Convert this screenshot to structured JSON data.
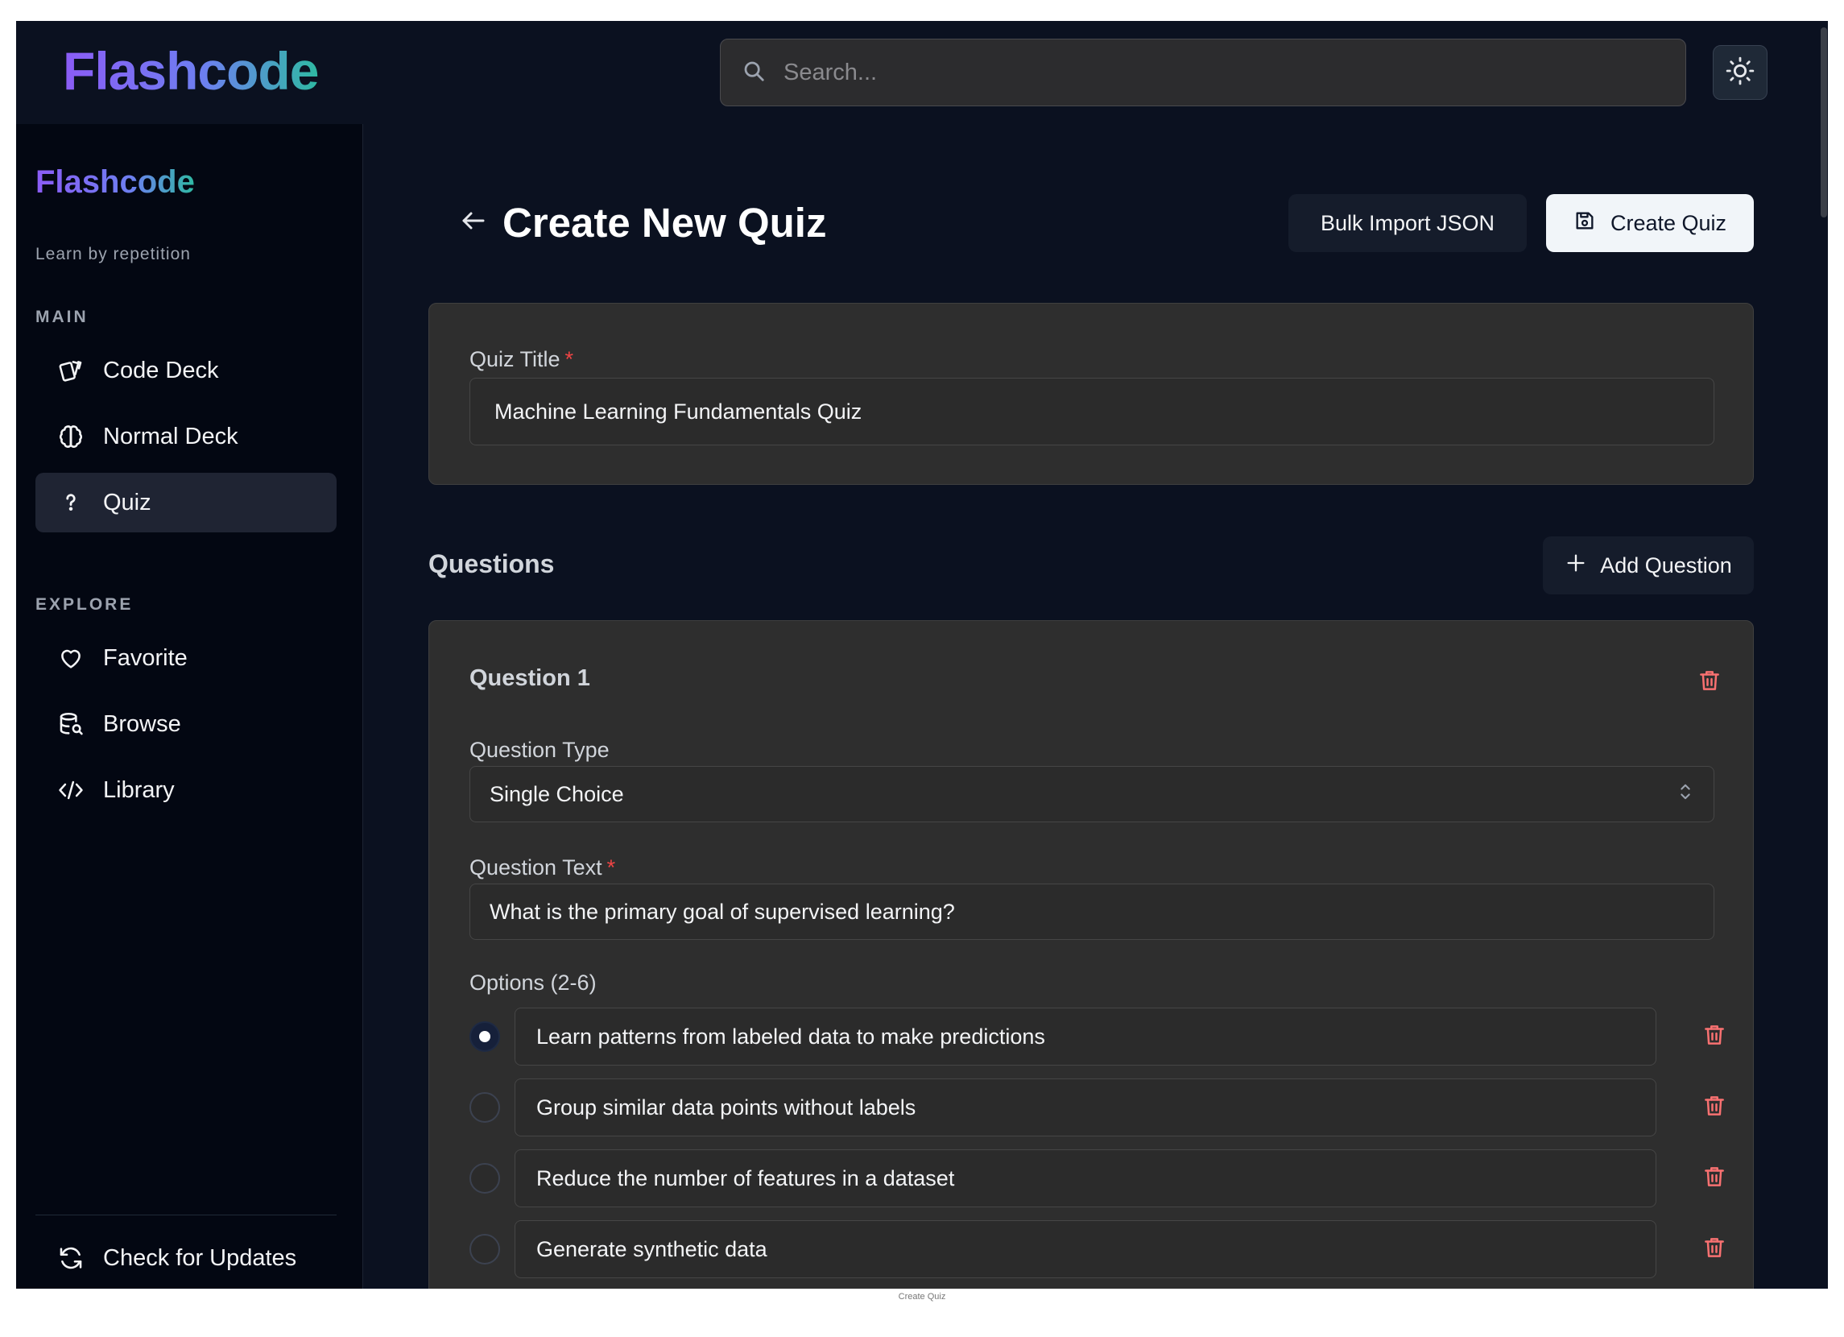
{
  "header": {
    "logo": "Flashcode",
    "search_placeholder": "Search...",
    "search_value": ""
  },
  "sidebar": {
    "brand": "Flashcode",
    "tagline": "Learn by repetition",
    "main_label": "MAIN",
    "main_items": [
      {
        "label": "Code Deck",
        "icon": "cards-icon"
      },
      {
        "label": "Normal Deck",
        "icon": "brain-icon"
      },
      {
        "label": "Quiz",
        "icon": "question-mark-icon",
        "active": true
      }
    ],
    "explore_label": "EXPLORE",
    "explore_items": [
      {
        "label": "Favorite",
        "icon": "heart-icon"
      },
      {
        "label": "Browse",
        "icon": "database-search-icon"
      },
      {
        "label": "Library",
        "icon": "code-icon"
      }
    ],
    "footer_item": {
      "label": "Check for Updates",
      "icon": "refresh-icon"
    }
  },
  "page": {
    "title": "Create New Quiz",
    "bulk_import_label": "Bulk Import JSON",
    "create_label": "Create Quiz",
    "quiz_title_label": "Quiz Title",
    "required_mark": "*",
    "quiz_title_value": "Machine Learning Fundamentals Quiz",
    "questions_heading": "Questions",
    "add_question_label": "Add Question"
  },
  "question": {
    "heading": "Question 1",
    "type_label": "Question Type",
    "type_value": "Single Choice",
    "text_label": "Question Text",
    "text_value": "What is the primary goal of supervised learning?",
    "options_label": "Options (2-6)",
    "options": [
      {
        "text": "Learn patterns from labeled data to make predictions",
        "selected": true
      },
      {
        "text": "Group similar data points without labels",
        "selected": false
      },
      {
        "text": "Reduce the number of features in a dataset",
        "selected": false
      },
      {
        "text": "Generate synthetic data",
        "selected": false
      }
    ]
  },
  "caption": "Create Quiz",
  "colors": {
    "background": "#0b1120",
    "sidebar": "#030712",
    "card": "#2e2e2e",
    "accent_purple": "#8b5cf6",
    "accent_teal": "#2fb9a3",
    "danger": "#f87171"
  }
}
